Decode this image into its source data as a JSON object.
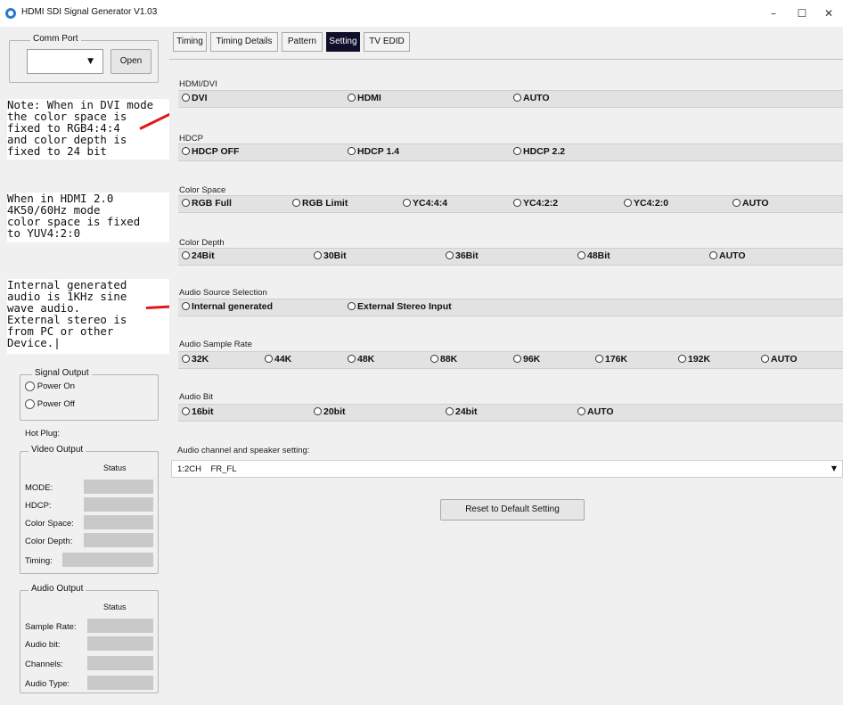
{
  "window": {
    "title": "HDMI SDI Signal Generator V1.03",
    "minimize": "–",
    "maximize": "☐",
    "close": "✕"
  },
  "comm_port": {
    "label": "Comm Port",
    "value": "",
    "open_label": "Open"
  },
  "notes": {
    "dvi": "Note: When in DVI mode\nthe color space is\nfixed to RGB4:4:4\nand color depth is\nfixed to 24 bit",
    "hdmi": "When in HDMI 2.0\n4K50/60Hz mode\ncolor space is fixed\nto YUV4:2:0",
    "audio": "Internal generated\naudio is 1KHz sine\nwave audio.\nExternal stereo is\nfrom PC or other\nDevice.|"
  },
  "signal_output": {
    "label": "Signal Output",
    "power_on": "Power On",
    "power_off": "Power Off"
  },
  "hot_plug": {
    "label": "Hot Plug:"
  },
  "video_output": {
    "label": "Video Output",
    "status": "Status",
    "mode": "MODE:",
    "hdcp": "HDCP:",
    "color_space": "Color Space:",
    "color_depth": "Color Depth:",
    "timing": "Timing:"
  },
  "audio_output": {
    "label": "Audio Output",
    "status": "Status",
    "sample_rate": "Sample Rate:",
    "audio_bit": "Audio bit:",
    "channels": "Channels:",
    "audio_type": "Audio Type:"
  },
  "tabs": [
    "Timing",
    "Timing Details",
    "Pattern",
    "Setting",
    "TV EDID"
  ],
  "active_tab": "Setting",
  "sections": {
    "hdmi_dvi": {
      "label": "HDMI/DVI",
      "options": [
        "DVI",
        "HDMI",
        "AUTO"
      ]
    },
    "hdcp": {
      "label": "HDCP",
      "options": [
        "HDCP OFF",
        "HDCP 1.4",
        "HDCP 2.2"
      ]
    },
    "color_space": {
      "label": "Color Space",
      "options": [
        "RGB Full",
        "RGB Limit",
        "YC4:4:4",
        "YC4:2:2",
        "YC4:2:0",
        "AUTO"
      ]
    },
    "color_depth": {
      "label": "Color Depth",
      "options": [
        "24Bit",
        "30Bit",
        "36Bit",
        "48Bit",
        "AUTO"
      ]
    },
    "audio_source": {
      "label": "Audio Source Selection",
      "options": [
        "Internal generated",
        "External Stereo Input"
      ]
    },
    "audio_sample_rate": {
      "label": "Audio Sample Rate",
      "options": [
        "32K",
        "44K",
        "48K",
        "88K",
        "96K",
        "176K",
        "192K",
        "AUTO"
      ]
    },
    "audio_bit": {
      "label": "Audio Bit",
      "options": [
        "16bit",
        "20bit",
        "24bit",
        "AUTO"
      ]
    }
  },
  "audio_channel": {
    "label": "Audio channel and speaker setting:",
    "value": "1:2CH    FR_FL"
  },
  "reset_button": "Reset to Default Setting",
  "colors": {
    "active_tab": "#0f0f2a",
    "annotation_line": "#e01818",
    "app_icon": "#2a7bd0"
  }
}
